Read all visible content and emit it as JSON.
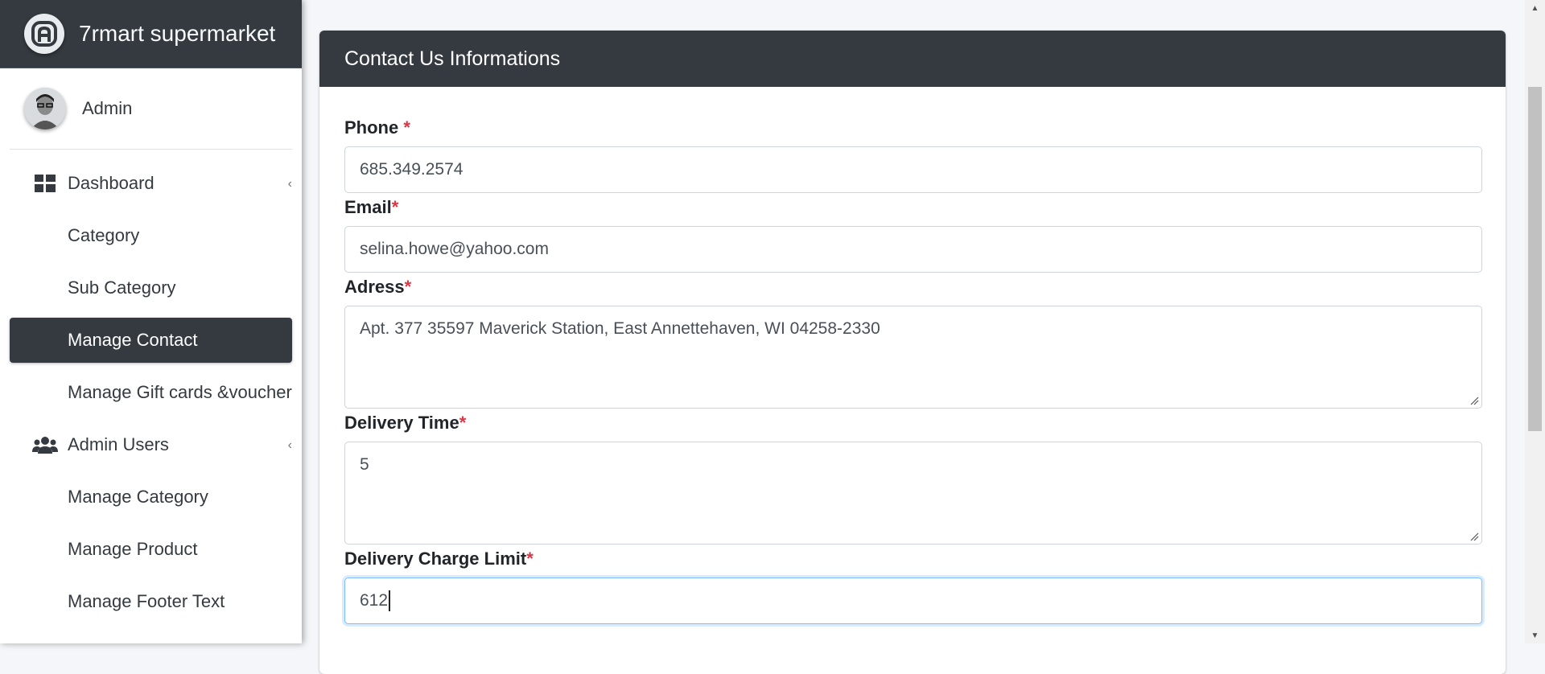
{
  "brand": {
    "name": "7rmart supermarket",
    "logo_icon": "brand-logo-icon"
  },
  "user": {
    "name": "Admin"
  },
  "sidebar": {
    "items": [
      {
        "label": "Dashboard",
        "icon": "dashboard-icon",
        "has_caret": true,
        "active": false
      },
      {
        "label": "Category",
        "active": false
      },
      {
        "label": "Sub Category",
        "active": false
      },
      {
        "label": "Manage Contact",
        "active": true
      },
      {
        "label": "Manage Gift cards &voucher",
        "active": false
      },
      {
        "label": "Admin Users",
        "icon": "users-icon",
        "has_caret": true,
        "active": false
      },
      {
        "label": "Manage Category",
        "active": false
      },
      {
        "label": "Manage Product",
        "active": false
      },
      {
        "label": "Manage Footer Text",
        "active": false
      }
    ]
  },
  "card": {
    "title": "Contact Us Informations",
    "fields": {
      "phone": {
        "label": "Phone",
        "required_mark": "*",
        "value": "685.349.2574"
      },
      "email": {
        "label": "Email",
        "required_mark": "*",
        "value": "selina.howe@yahoo.com"
      },
      "address": {
        "label": "Adress",
        "required_mark": "*",
        "value": "Apt. 377 35597 Maverick Station, East Annettehaven, WI 04258-2330"
      },
      "delivery_time": {
        "label": "Delivery Time",
        "required_mark": "*",
        "value": "5"
      },
      "delivery_charge_limit": {
        "label": "Delivery Charge Limit",
        "required_mark": "*",
        "value": "612"
      }
    }
  },
  "colors": {
    "dark": "#343a40",
    "required": "#dc3545",
    "focus_border": "#80bdff"
  }
}
